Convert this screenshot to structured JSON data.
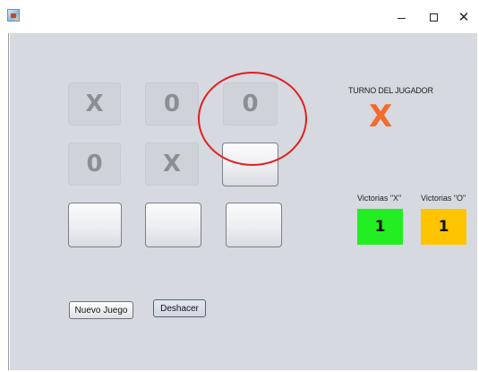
{
  "window": {
    "controls": {
      "minimize_icon": "minimize-icon",
      "maximize_icon": "maximize-icon",
      "close_icon": "close-icon",
      "close_glyph": "✕"
    }
  },
  "board": {
    "cells": [
      "X",
      "0",
      "0",
      "0",
      "X",
      "",
      "",
      "",
      ""
    ]
  },
  "turn": {
    "label": "TURNO DEL JUGADOR",
    "symbol": "X",
    "symbol_color": "#f36b2a"
  },
  "scores": {
    "x_label": "Victorias \"X\"",
    "o_label": "Victorias \"O\"",
    "x_value": "1",
    "o_value": "1",
    "x_color": "#22ee22",
    "o_color": "#ffc400"
  },
  "buttons": {
    "new_game": "Nuevo Juego",
    "undo": "Deshacer"
  },
  "annotation": {
    "highlight_color": "#e02020"
  }
}
